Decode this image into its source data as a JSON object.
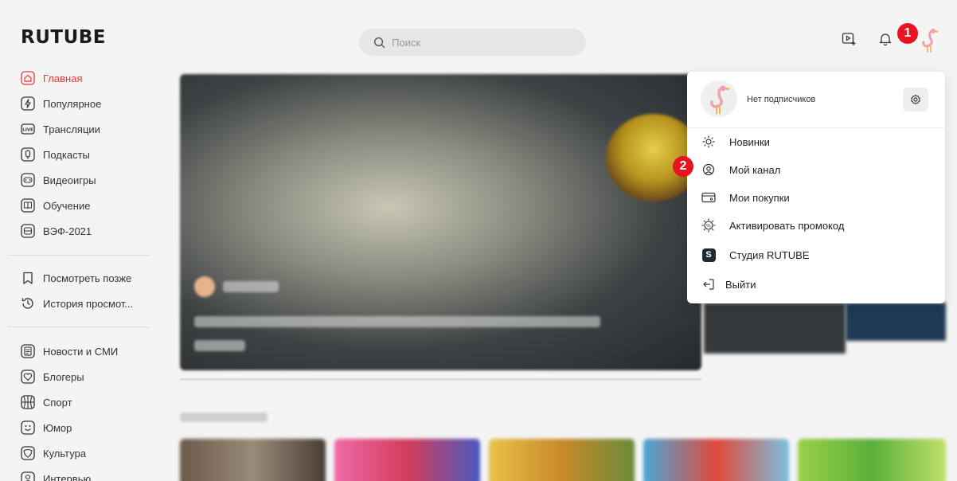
{
  "header": {
    "logo": "RUTUBE",
    "search_placeholder": "Поиск"
  },
  "badges": {
    "first": "1",
    "second": "2"
  },
  "sidebar": {
    "primary": [
      {
        "label": "Главная",
        "icon": "home-icon",
        "active": true
      },
      {
        "label": "Популярное",
        "icon": "lightning-icon"
      },
      {
        "label": "Трансляции",
        "icon": "live-icon"
      },
      {
        "label": "Подкасты",
        "icon": "podcast-icon"
      },
      {
        "label": "Видеоигры",
        "icon": "gamepad-icon"
      },
      {
        "label": "Обучение",
        "icon": "book-icon"
      },
      {
        "label": "ВЭФ-2021",
        "icon": "forum-icon"
      }
    ],
    "secondary": [
      {
        "label": "Посмотреть позже",
        "icon": "bookmark-icon"
      },
      {
        "label": "История просмот...",
        "icon": "history-icon"
      }
    ],
    "categories": [
      {
        "label": "Новости и СМИ",
        "icon": "news-icon"
      },
      {
        "label": "Блогеры",
        "icon": "heart-icon"
      },
      {
        "label": "Спорт",
        "icon": "basketball-icon"
      },
      {
        "label": "Юмор",
        "icon": "smile-icon"
      },
      {
        "label": "Культура",
        "icon": "culture-icon"
      },
      {
        "label": "Интервью",
        "icon": "interview-icon"
      }
    ]
  },
  "dropdown": {
    "subscribers": "Нет подписчиков",
    "items": [
      {
        "label": "Новинки",
        "icon": "sun-icon"
      },
      {
        "label": "Мой канал",
        "icon": "user-circle-icon"
      },
      {
        "label": "Мои покупки",
        "icon": "wallet-icon"
      },
      {
        "label": "Активировать промокод",
        "icon": "promo-icon"
      },
      {
        "label": "Студия RUTUBE",
        "icon": "studio-icon",
        "glyph": "S"
      },
      {
        "label": "Выйти",
        "icon": "logout-icon"
      }
    ]
  },
  "colors": {
    "accent": "#e8363c",
    "badge": "#e8141f",
    "studio_square": "#1f2a36"
  }
}
